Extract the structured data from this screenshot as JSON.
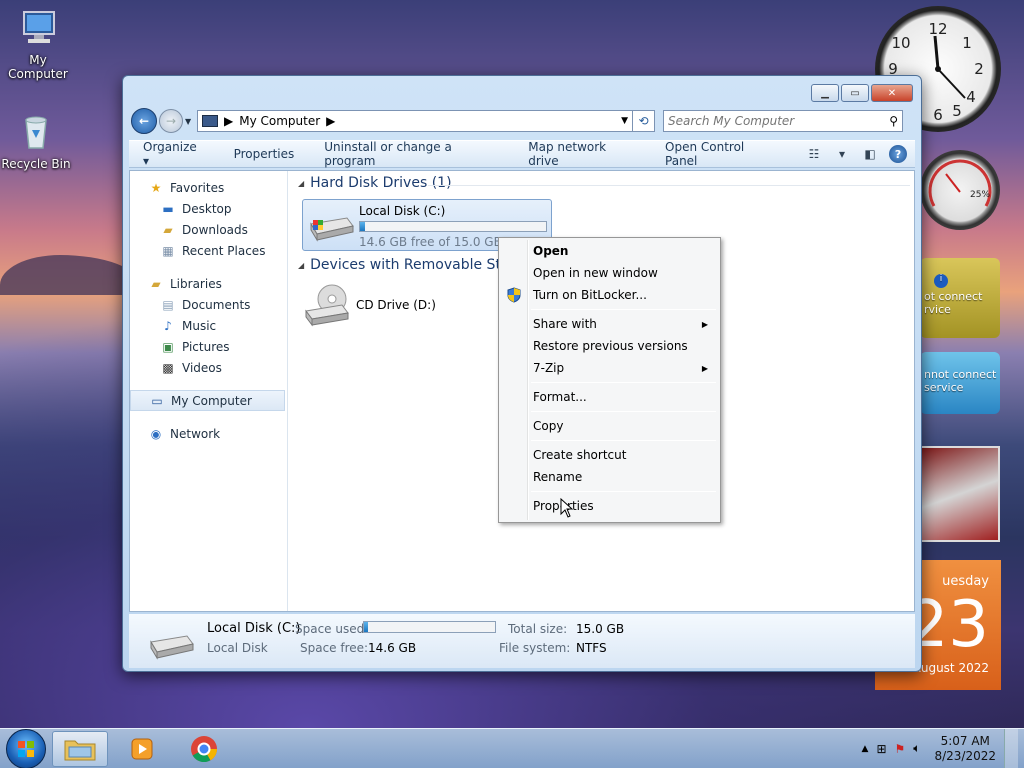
{
  "desktop": {
    "icons": [
      {
        "label": "My Computer"
      },
      {
        "label": "Recycle Bin"
      }
    ]
  },
  "gadgets": {
    "meter_value": "25%",
    "weather1_text": "ot connect\nrvice",
    "weather2_text": "nnot connect\nservice",
    "calendar_day": "uesday",
    "calendar_num": "23",
    "calendar_month": "August 2022"
  },
  "window": {
    "address": {
      "crumb": "My Computer"
    },
    "search_placeholder": "Search My Computer",
    "toolbar": {
      "organize": "Organize",
      "properties": "Properties",
      "uninstall": "Uninstall or change a program",
      "map_drive": "Map network drive",
      "control_panel": "Open Control Panel"
    },
    "nav": {
      "favorites": "Favorites",
      "desktop": "Desktop",
      "downloads": "Downloads",
      "recent": "Recent Places",
      "libraries": "Libraries",
      "documents": "Documents",
      "music": "Music",
      "pictures": "Pictures",
      "videos": "Videos",
      "my_computer": "My Computer",
      "network": "Network"
    },
    "groups": {
      "hdd": "Hard Disk Drives (1)",
      "removable": "Devices with Removable Sto"
    },
    "drive_c": {
      "name": "Local Disk (C:)",
      "free": "14.6 GB free of 15.0 GB",
      "used_fraction": 0.027
    },
    "drive_d": {
      "name": "CD Drive (D:)"
    },
    "details": {
      "name": "Local Disk (C:)",
      "type": "Local Disk",
      "space_used_label": "Space used:",
      "space_free_label": "Space free:",
      "space_free": "14.6 GB",
      "total_size_label": "Total size:",
      "total_size": "15.0 GB",
      "fs_label": "File system:",
      "fs": "NTFS"
    }
  },
  "context_menu": {
    "open": "Open",
    "open_new": "Open in new window",
    "bitlocker": "Turn on BitLocker...",
    "share": "Share with",
    "restore": "Restore previous versions",
    "sevenzip": "7-Zip",
    "format": "Format...",
    "copy": "Copy",
    "shortcut": "Create shortcut",
    "rename": "Rename",
    "properties": "Properties"
  },
  "taskbar": {
    "time": "5:07 AM",
    "date": "8/23/2022"
  }
}
